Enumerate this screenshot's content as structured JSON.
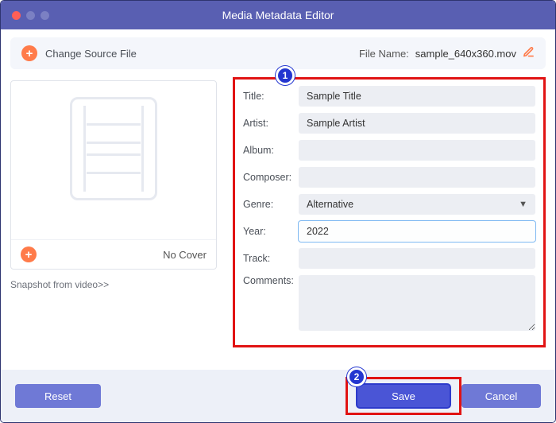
{
  "window": {
    "title": "Media Metadata Editor"
  },
  "toolbar": {
    "change_source": "Change Source File",
    "file_name_label": "File Name:",
    "file_name_value": "sample_640x360.mov"
  },
  "cover": {
    "no_cover": "No Cover",
    "snapshot_link": "Snapshot from video>>"
  },
  "fields": {
    "title_label": "Title:",
    "title_value": "Sample Title",
    "artist_label": "Artist:",
    "artist_value": "Sample Artist",
    "album_label": "Album:",
    "album_value": "",
    "composer_label": "Composer:",
    "composer_value": "",
    "genre_label": "Genre:",
    "genre_value": "Alternative",
    "year_label": "Year:",
    "year_value": "2022",
    "track_label": "Track:",
    "track_value": "",
    "comments_label": "Comments:",
    "comments_value": ""
  },
  "buttons": {
    "reset": "Reset",
    "save": "Save",
    "cancel": "Cancel"
  },
  "callouts": {
    "one": "1",
    "two": "2"
  }
}
